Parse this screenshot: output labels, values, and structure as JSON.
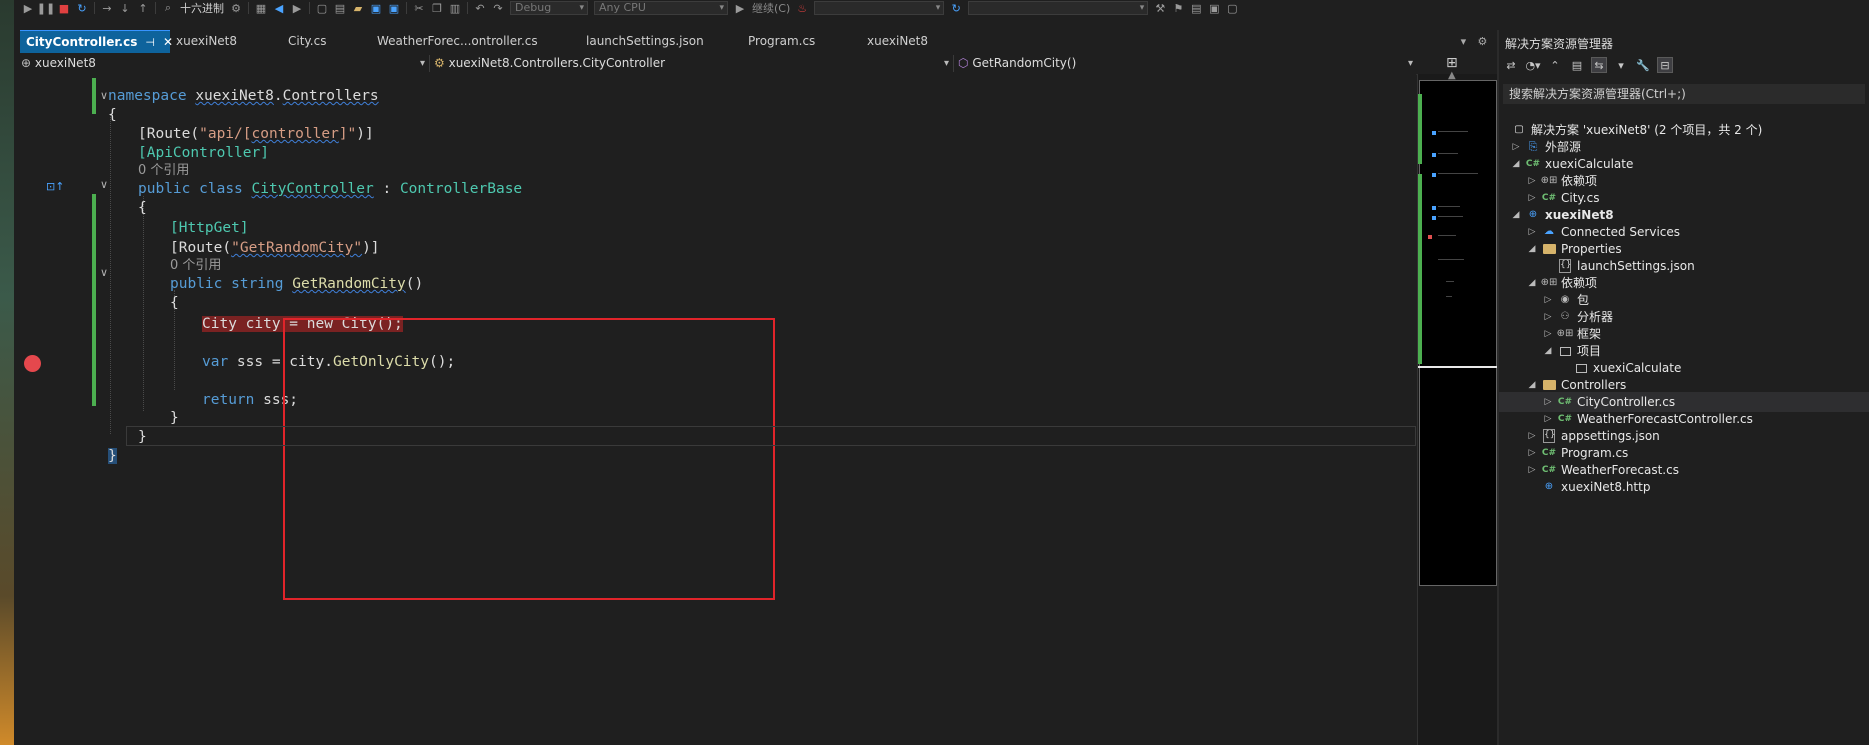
{
  "toolbar": {
    "hex_label": "十六进制",
    "config_value": "Debug",
    "platform_value": "Any CPU",
    "continue_label": "继续(C)"
  },
  "tabs": [
    {
      "label": "CityController.cs"
    },
    {
      "label": "xuexiNet8"
    },
    {
      "label": "City.cs"
    },
    {
      "label": "WeatherForec...ontroller.cs"
    },
    {
      "label": "launchSettings.json"
    },
    {
      "label": "Program.cs"
    },
    {
      "label": "xuexiNet8"
    }
  ],
  "navbar": {
    "project": "xuexiNet8",
    "class_path": "xuexiNet8.Controllers.CityController",
    "member": "GetRandomCity()"
  },
  "code": {
    "namespace_kw": "namespace",
    "namespace_name": "xuexiNet8",
    "namespace_dot": ".",
    "namespace_sub": "Controllers",
    "open_brace": "{",
    "route_open": "[Route(",
    "route_str": "\"api/[",
    "route_ctrl": "controller",
    "route_str_end": "]\"",
    "route_close": ")]",
    "api_controller": "[ApiController]",
    "refs": "0 个引用",
    "public_kw": "public",
    "class_kw": "class",
    "class_name": "CityController",
    "colon": " : ",
    "base_class": "ControllerBase",
    "http_get": "[HttpGet]",
    "route2_open": "[Route(",
    "route2_str": "\"GetRandomCity\"",
    "route2_close": ")]",
    "refs2": "0 个引用",
    "string_kw": "string",
    "method_name": "GetRandomCity",
    "method_parens": "()",
    "bp_line": "City city = new City();",
    "var_kw": "var",
    "var_rest": " sss = city.",
    "get_only": "GetOnlyCity",
    "call_end": "();",
    "return_kw": "return",
    "return_rest": " sss;",
    "close_brace": "}"
  },
  "solution_explorer": {
    "title": "解决方案资源管理器",
    "search_placeholder": "搜索解决方案资源管理器(Ctrl+;)",
    "items": [
      {
        "label": "解决方案 'xuexiNet8' (2 个项目，共 2 个)"
      },
      {
        "label": "外部源"
      },
      {
        "label": "xuexiCalculate"
      },
      {
        "label": "依赖项"
      },
      {
        "label": "City.cs"
      },
      {
        "label": "xuexiNet8"
      },
      {
        "label": "Connected Services"
      },
      {
        "label": "Properties"
      },
      {
        "label": "launchSettings.json"
      },
      {
        "label": "依赖项"
      },
      {
        "label": "包"
      },
      {
        "label": "分析器"
      },
      {
        "label": "框架"
      },
      {
        "label": "项目"
      },
      {
        "label": "xuexiCalculate"
      },
      {
        "label": "Controllers"
      },
      {
        "label": "CityController.cs"
      },
      {
        "label": "WeatherForecastController.cs"
      },
      {
        "label": "appsettings.json"
      },
      {
        "label": "Program.cs"
      },
      {
        "label": "WeatherForecast.cs"
      },
      {
        "label": "xuexiNet8.http"
      }
    ]
  }
}
